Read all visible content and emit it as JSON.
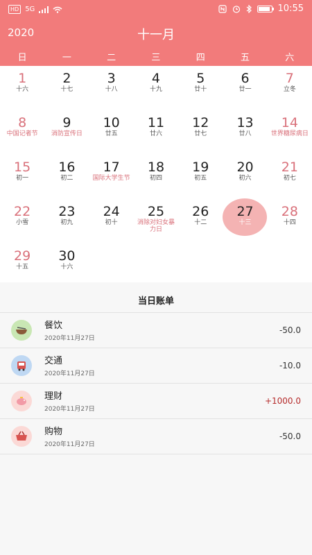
{
  "status_bar": {
    "hd": "HD",
    "network": "5G",
    "time": "10:55"
  },
  "header": {
    "year": "2020",
    "month": "十一月"
  },
  "weekdays": [
    "日",
    "一",
    "二",
    "三",
    "四",
    "五",
    "六"
  ],
  "calendar": {
    "weeks": [
      [
        {
          "day": "1",
          "sub": "十六",
          "weekend": true
        },
        {
          "day": "2",
          "sub": "十七"
        },
        {
          "day": "3",
          "sub": "十八"
        },
        {
          "day": "4",
          "sub": "十九"
        },
        {
          "day": "5",
          "sub": "廿十"
        },
        {
          "day": "6",
          "sub": "廿一"
        },
        {
          "day": "7",
          "sub": "立冬",
          "weekend": true
        }
      ],
      [
        {
          "day": "8",
          "sub": "中国记者节",
          "weekend": true,
          "holiday": true
        },
        {
          "day": "9",
          "sub": "消防宣传日",
          "holiday": true
        },
        {
          "day": "10",
          "sub": "廿五"
        },
        {
          "day": "11",
          "sub": "廿六"
        },
        {
          "day": "12",
          "sub": "廿七"
        },
        {
          "day": "13",
          "sub": "廿八"
        },
        {
          "day": "14",
          "sub": "世界糖尿病日",
          "weekend": true,
          "holiday": true
        }
      ],
      [
        {
          "day": "15",
          "sub": "初一",
          "weekend": true
        },
        {
          "day": "16",
          "sub": "初二"
        },
        {
          "day": "17",
          "sub": "国际大学生节",
          "holiday": true
        },
        {
          "day": "18",
          "sub": "初四"
        },
        {
          "day": "19",
          "sub": "初五"
        },
        {
          "day": "20",
          "sub": "初六"
        },
        {
          "day": "21",
          "sub": "初七",
          "weekend": true
        }
      ],
      [
        {
          "day": "22",
          "sub": "小雪",
          "weekend": true
        },
        {
          "day": "23",
          "sub": "初九"
        },
        {
          "day": "24",
          "sub": "初十"
        },
        {
          "day": "25",
          "sub": "消除对妇女暴力日",
          "holiday": true
        },
        {
          "day": "26",
          "sub": "十二"
        },
        {
          "day": "27",
          "sub": "十三",
          "selected": true
        },
        {
          "day": "28",
          "sub": "十四",
          "weekend": true
        }
      ],
      [
        {
          "day": "29",
          "sub": "十五",
          "weekend": true
        },
        {
          "day": "30",
          "sub": "十六"
        }
      ]
    ]
  },
  "bill": {
    "title": "当日账单",
    "items": [
      {
        "icon": "bowl-icon",
        "icon_bg": "#c9e7b4",
        "category": "餐饮",
        "date": "2020年11月27日",
        "amount": "-50.0",
        "income": false
      },
      {
        "icon": "bus-icon",
        "icon_bg": "#bfd8f3",
        "category": "交通",
        "date": "2020年11月27日",
        "amount": "-10.0",
        "income": false
      },
      {
        "icon": "piggy-bank-icon",
        "icon_bg": "#fbd9d6",
        "category": "理财",
        "date": "2020年11月27日",
        "amount": "+1000.0",
        "income": true
      },
      {
        "icon": "basket-icon",
        "icon_bg": "#fbd9d6",
        "category": "购物",
        "date": "2020年11月27日",
        "amount": "-50.0",
        "income": false
      }
    ]
  }
}
